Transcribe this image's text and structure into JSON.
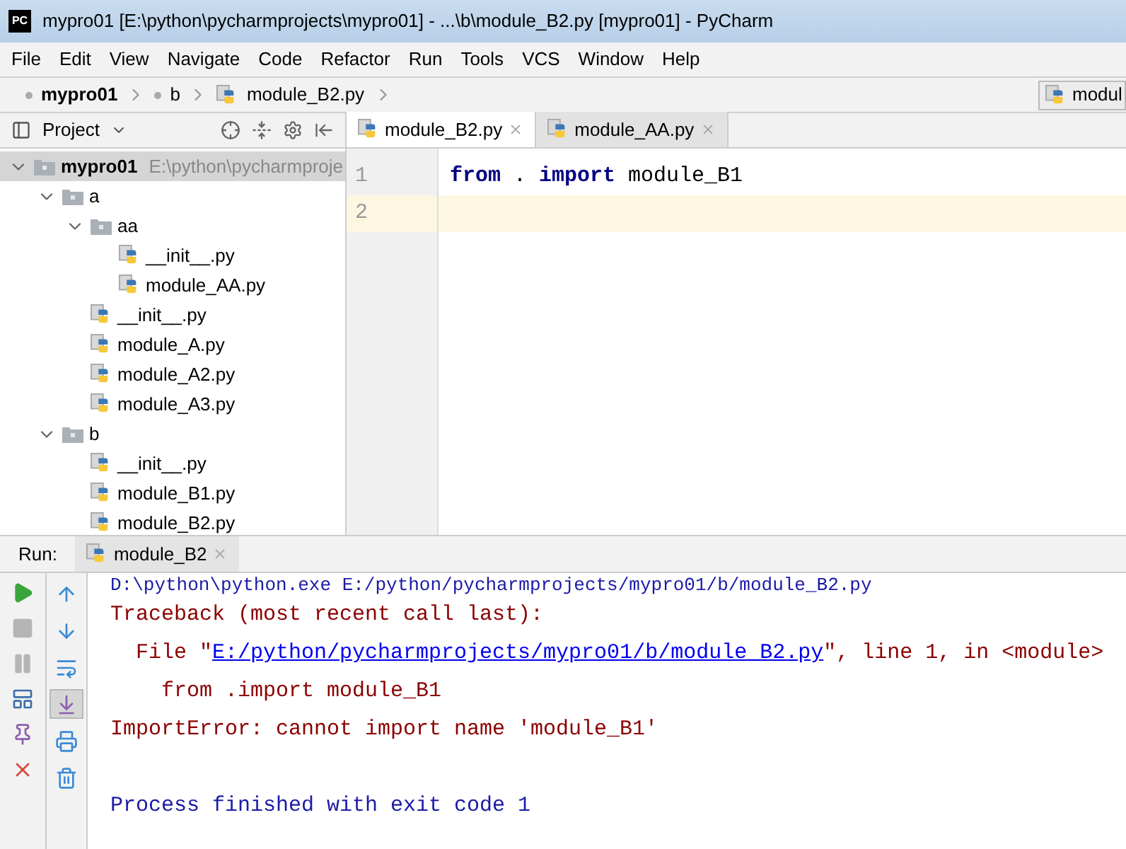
{
  "window": {
    "title": "mypro01 [E:\\python\\pycharmprojects\\mypro01] - ...\\b\\module_B2.py [mypro01] - PyCharm",
    "logo": "PC"
  },
  "menu": [
    "File",
    "Edit",
    "View",
    "Navigate",
    "Code",
    "Refactor",
    "Run",
    "Tools",
    "VCS",
    "Window",
    "Help"
  ],
  "breadcrumbs": [
    {
      "label": "mypro01",
      "kind": "project"
    },
    {
      "label": "b",
      "kind": "folder"
    },
    {
      "label": "module_B2.py",
      "kind": "file"
    }
  ],
  "run_config": {
    "label": "modul"
  },
  "project_panel": {
    "title": "Project"
  },
  "tree": [
    {
      "label": "mypro01",
      "path": "E:\\python\\pycharmproje",
      "kind": "project",
      "expanded": true,
      "selected": true,
      "children": [
        {
          "label": "a",
          "kind": "folder",
          "expanded": true,
          "selected": false,
          "children": [
            {
              "label": "aa",
              "kind": "folder",
              "expanded": true,
              "selected": false,
              "children": [
                {
                  "label": "__init__.py",
                  "kind": "file",
                  "selected": false
                },
                {
                  "label": "module_AA.py",
                  "kind": "file",
                  "selected": false
                }
              ]
            },
            {
              "label": "__init__.py",
              "kind": "file",
              "selected": false
            },
            {
              "label": "module_A.py",
              "kind": "file",
              "selected": false
            },
            {
              "label": "module_A2.py",
              "kind": "file",
              "selected": false
            },
            {
              "label": "module_A3.py",
              "kind": "file",
              "selected": false
            }
          ]
        },
        {
          "label": "b",
          "kind": "folder",
          "expanded": true,
          "selected": false,
          "children": [
            {
              "label": "__init__.py",
              "kind": "file",
              "selected": false
            },
            {
              "label": "module_B1.py",
              "kind": "file",
              "selected": false
            },
            {
              "label": "module_B2.py",
              "kind": "file",
              "selected": false
            }
          ]
        }
      ]
    }
  ],
  "editor_tabs": [
    {
      "label": "module_B2.py",
      "selected": true
    },
    {
      "label": "module_AA.py",
      "selected": false
    }
  ],
  "code_lines": [
    {
      "number": "1",
      "current": false,
      "tokens": [
        {
          "text": "from",
          "kind": "keyword"
        },
        {
          "text": " . ",
          "kind": "plain"
        },
        {
          "text": "import",
          "kind": "keyword"
        },
        {
          "text": " module_B1",
          "kind": "plain"
        }
      ]
    },
    {
      "number": "2",
      "current": true
    }
  ],
  "run_panel": {
    "label": "Run:",
    "tab": "module_B2"
  },
  "run_toolbar": [
    {
      "kind": "play",
      "disabled": false
    },
    {
      "kind": "stop",
      "disabled": true
    },
    {
      "kind": "pause",
      "disabled": true
    },
    {
      "kind": "layout",
      "disabled": false
    },
    {
      "kind": "pin",
      "disabled": false
    },
    {
      "kind": "close",
      "disabled": false
    }
  ],
  "run_toolbar_2": [
    {
      "kind": "up",
      "selected": false
    },
    {
      "kind": "down",
      "selected": false
    },
    {
      "kind": "wrap",
      "selected": false
    },
    {
      "kind": "scroll_end",
      "selected": true
    },
    {
      "kind": "print",
      "selected": false
    },
    {
      "kind": "trash",
      "selected": false
    }
  ],
  "console": [
    {
      "kind": "command",
      "text": "D:\\python\\python.exe E:/python/pycharmprojects/mypro01/b/module_B2.py"
    },
    {
      "kind": "error",
      "text": "Traceback (most recent call last):"
    },
    {
      "kind": "file_ref",
      "prefix": "  File \"",
      "link": "E:/python/pycharmprojects/mypro01/b/module_B2.py",
      "suffix": "\", line 1, in <module>"
    },
    {
      "kind": "error",
      "text": "    from .import module_B1"
    },
    {
      "kind": "error",
      "text": "ImportError: cannot import name 'module_B1'"
    },
    {
      "kind": "blank"
    },
    {
      "kind": "info",
      "text": "Process finished with exit code 1"
    }
  ]
}
